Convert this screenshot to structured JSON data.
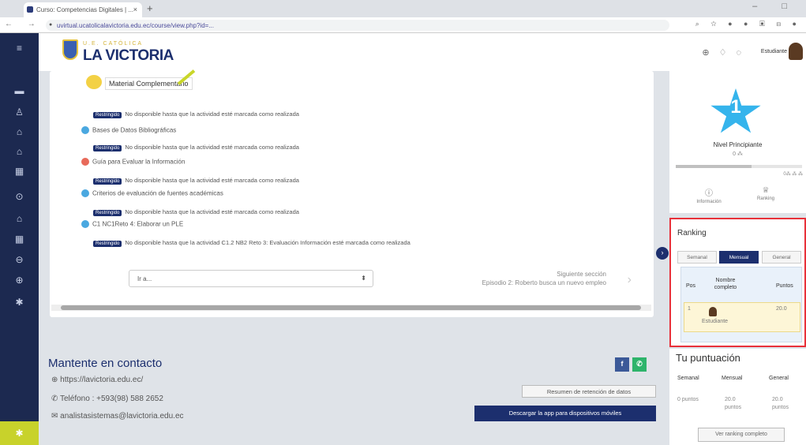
{
  "browser": {
    "tab_title": "Curso: Competencias Digitales | ...",
    "url": "uvirtual.ucatolicalavictoria.edu.ec/course/view.php?id=...",
    "nav_icons": "← → C",
    "ext_icons": "⌕ ☆ ● ● ▣ ⊟ ●",
    "window_controls": "– □"
  },
  "header": {
    "logo_small": "U.E. CATÓLICA",
    "logo_big": "LA VICTORIA",
    "user_label": "Estudiante",
    "icons": [
      "globe-icon",
      "bell-icon",
      "chat-icon"
    ]
  },
  "main": {
    "material_title": "Material Complementario",
    "restricted_badge": "Restringido",
    "rows": [
      {
        "type": "restriction",
        "text": "No disponible hasta que la actividad esté marcada como realizada"
      },
      {
        "type": "activity",
        "color": "#4aa8e0",
        "text": "Bases de Datos Bibliográficas"
      },
      {
        "type": "restriction",
        "text": "No disponible hasta que la actividad esté marcada como realizada"
      },
      {
        "type": "activity",
        "color": "#e86a5a",
        "text": "Guía para Evaluar la Información"
      },
      {
        "type": "restriction",
        "text": "No disponible hasta que la actividad esté marcada como realizada"
      },
      {
        "type": "activity",
        "color": "#4aa8e0",
        "text": "Criterios de evaluación de fuentes académicas"
      },
      {
        "type": "restriction",
        "text": "No disponible hasta que la actividad esté marcada como realizada"
      },
      {
        "type": "activity",
        "color": "#4aa8e0",
        "text": "C1 NC1Reto 4: Elaborar un PLE"
      },
      {
        "type": "restriction",
        "text": "No disponible hasta que la actividad C1.2 NB2 Reto 3: Evaluación Información esté marcada como realizada"
      }
    ],
    "goto_select": "Ir a...",
    "next_section_label": "Siguiente sección",
    "next_section_name": "Episodio 2: Roberto busca un nuevo empleo"
  },
  "footer": {
    "title": "Mantente en contacto",
    "website": "https://lavictoria.edu.ec/",
    "phone": "Teléfono : +593(98) 588 2652",
    "email": "analistasistemas@lavictoria.edu.ec",
    "resumen_button": "Resumen de retención de datos",
    "download_button": "Descargar la app para dispositivos móviles",
    "social_colors": [
      "#3b5998",
      "#2eb46b"
    ]
  },
  "level_card": {
    "level_number": "1",
    "level_name": "Nivel Principiante",
    "level_xp": "0 ⁂",
    "progress_fraction": 0.6,
    "progress_label": "0⁂ ⁂ ⁂",
    "link_info": "Información",
    "link_ranking": "Ranking"
  },
  "ranking": {
    "title": "Ranking",
    "tabs": [
      "Semanal",
      "Mensual",
      "General"
    ],
    "active_tab": 1,
    "headers": {
      "pos": "Pos",
      "name": "Nombre completo",
      "points": "Puntos"
    },
    "rows": [
      {
        "pos": "1",
        "name": "Estudiante",
        "points": "20.0"
      }
    ]
  },
  "your_score": {
    "title": "Tu puntuación",
    "headers": [
      "Semanal",
      "Mensual",
      "General"
    ],
    "values": [
      "0 puntos",
      "20.0 puntos",
      "20.0 puntos"
    ],
    "button": "Ver ranking completo"
  }
}
